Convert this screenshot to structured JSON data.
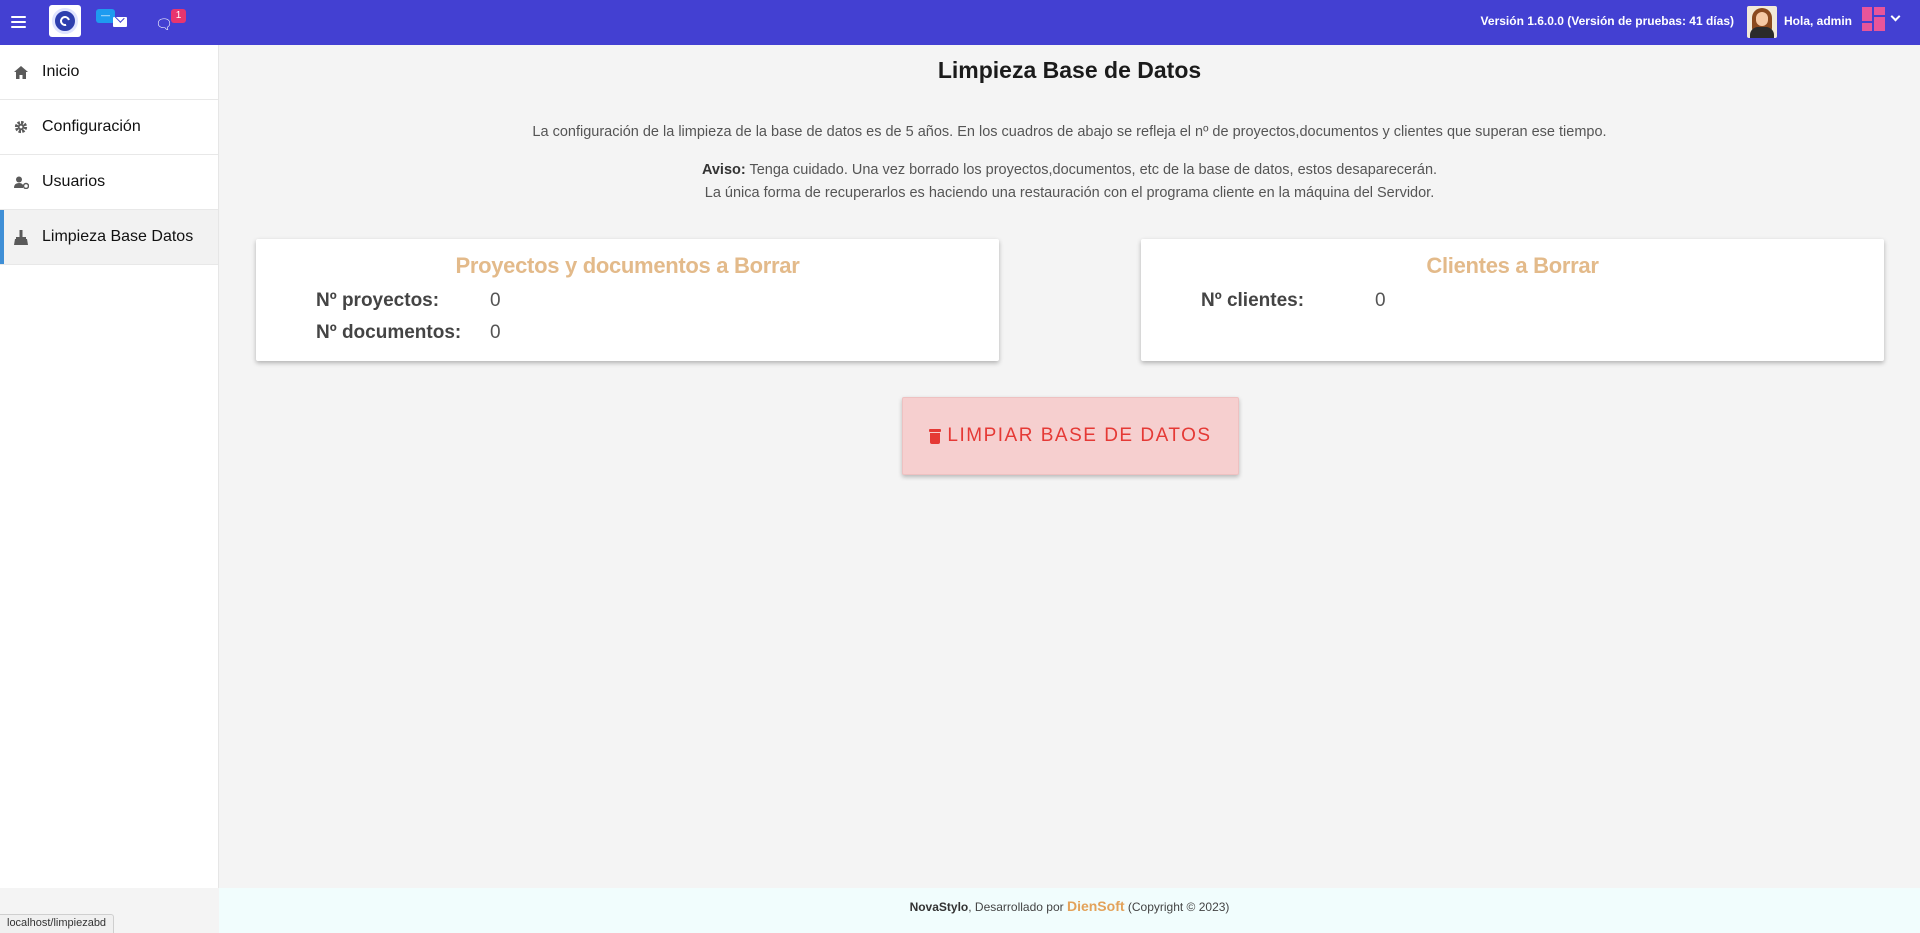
{
  "header": {
    "mail_badge": "—",
    "chat_badge": "1",
    "version": "Versión 1.6.0.0 (Versión de pruebas: 41 días)",
    "greeting": "Hola, admin"
  },
  "sidebar": {
    "items": [
      {
        "label": "Inicio",
        "icon": "home-icon"
      },
      {
        "label": "Configuración",
        "icon": "gear-icon"
      },
      {
        "label": "Usuarios",
        "icon": "users-cog-icon"
      },
      {
        "label": "Limpieza Base Datos",
        "icon": "broom-icon",
        "active": true
      }
    ]
  },
  "main": {
    "title": "Limpieza Base de Datos",
    "intro": "La configuración de la limpieza de la base de datos es de 5 años. En los cuadros de abajo se refleja el nº de proyectos,documentos y clientes que superan ese tiempo.",
    "warning_label": "Aviso:",
    "warning_line1": " Tenga cuidado. Una vez borrado los proyectos,documentos, etc de la base de datos, estos desaparecerán.",
    "warning_line2": "La única forma de recuperarlos es haciendo una restauración con el programa cliente en la máquina del Servidor.",
    "card_projects": {
      "title": "Proyectos y documentos a Borrar",
      "projects_label": "Nº proyectos:",
      "projects_value": "0",
      "documents_label": "Nº documentos:",
      "documents_value": "0"
    },
    "card_clients": {
      "title": "Clientes a Borrar",
      "clients_label": "Nº clientes:",
      "clients_value": "0"
    },
    "clean_button": "LIMPIAR BASE DE DATOS"
  },
  "footer": {
    "app": "NovaStylo",
    "developed_by": ", Desarrollado por ",
    "company": "DienSoft",
    "copyright": " (Copyright © 2023)"
  },
  "statusbar": {
    "url": "localhost/limpiezabd"
  },
  "colors": {
    "topbar": "#4340d2",
    "card_title": "#e3ba8a",
    "danger": "#e53935",
    "active_indicator": "#3f8fd6"
  }
}
